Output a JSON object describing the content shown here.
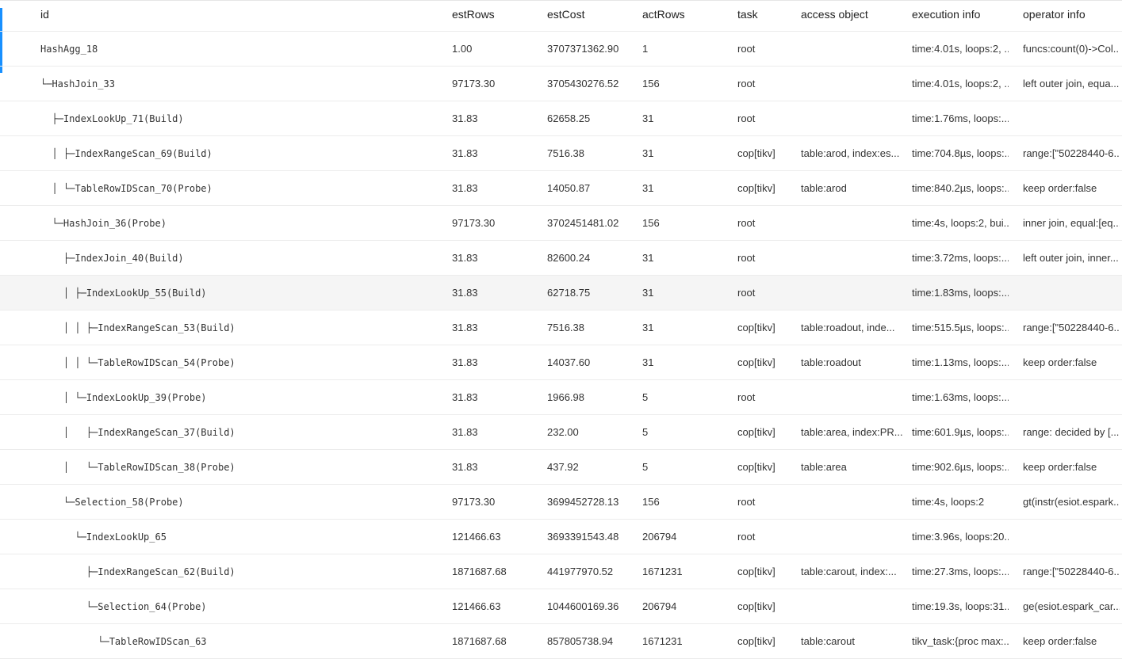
{
  "columns": {
    "id": "id",
    "estRows": "estRows",
    "estCost": "estCost",
    "actRows": "actRows",
    "task": "task",
    "access_object": "access object",
    "execution_info": "execution info",
    "operator_info": "operator info"
  },
  "rows": [
    {
      "id": "HashAgg_18",
      "estRows": "1.00",
      "estCost": "3707371362.90",
      "actRows": "1",
      "task": "root",
      "access": "",
      "exec": "time:4.01s, loops:2, ...",
      "op": "funcs:count(0)->Col..."
    },
    {
      "id": "└─HashJoin_33",
      "estRows": "97173.30",
      "estCost": "3705430276.52",
      "actRows": "156",
      "task": "root",
      "access": "",
      "exec": "time:4.01s, loops:2, ...",
      "op": "left outer join, equa..."
    },
    {
      "id": "  ├─IndexLookUp_71(Build)",
      "estRows": "31.83",
      "estCost": "62658.25",
      "actRows": "31",
      "task": "root",
      "access": "",
      "exec": "time:1.76ms, loops:...",
      "op": ""
    },
    {
      "id": "  │ ├─IndexRangeScan_69(Build)",
      "estRows": "31.83",
      "estCost": "7516.38",
      "actRows": "31",
      "task": "cop[tikv]",
      "access": "table:arod, index:es...",
      "exec": "time:704.8µs, loops:...",
      "op": "range:[\"50228440-6..."
    },
    {
      "id": "  │ └─TableRowIDScan_70(Probe)",
      "estRows": "31.83",
      "estCost": "14050.87",
      "actRows": "31",
      "task": "cop[tikv]",
      "access": "table:arod",
      "exec": "time:840.2µs, loops:...",
      "op": "keep order:false"
    },
    {
      "id": "  └─HashJoin_36(Probe)",
      "estRows": "97173.30",
      "estCost": "3702451481.02",
      "actRows": "156",
      "task": "root",
      "access": "",
      "exec": "time:4s, loops:2, bui...",
      "op": "inner join, equal:[eq..."
    },
    {
      "id": "    ├─IndexJoin_40(Build)",
      "estRows": "31.83",
      "estCost": "82600.24",
      "actRows": "31",
      "task": "root",
      "access": "",
      "exec": "time:3.72ms, loops:...",
      "op": "left outer join, inner..."
    },
    {
      "id": "    │ ├─IndexLookUp_55(Build)",
      "estRows": "31.83",
      "estCost": "62718.75",
      "actRows": "31",
      "task": "root",
      "access": "",
      "exec": "time:1.83ms, loops:...",
      "op": ""
    },
    {
      "id": "    │ │ ├─IndexRangeScan_53(Build)",
      "estRows": "31.83",
      "estCost": "7516.38",
      "actRows": "31",
      "task": "cop[tikv]",
      "access": "table:roadout, inde...",
      "exec": "time:515.5µs, loops:...",
      "op": "range:[\"50228440-6..."
    },
    {
      "id": "    │ │ └─TableRowIDScan_54(Probe)",
      "estRows": "31.83",
      "estCost": "14037.60",
      "actRows": "31",
      "task": "cop[tikv]",
      "access": "table:roadout",
      "exec": "time:1.13ms, loops:...",
      "op": "keep order:false"
    },
    {
      "id": "    │ └─IndexLookUp_39(Probe)",
      "estRows": "31.83",
      "estCost": "1966.98",
      "actRows": "5",
      "task": "root",
      "access": "",
      "exec": "time:1.63ms, loops:...",
      "op": ""
    },
    {
      "id": "    │   ├─IndexRangeScan_37(Build)",
      "estRows": "31.83",
      "estCost": "232.00",
      "actRows": "5",
      "task": "cop[tikv]",
      "access": "table:area, index:PR...",
      "exec": "time:601.9µs, loops:...",
      "op": "range: decided by [..."
    },
    {
      "id": "    │   └─TableRowIDScan_38(Probe)",
      "estRows": "31.83",
      "estCost": "437.92",
      "actRows": "5",
      "task": "cop[tikv]",
      "access": "table:area",
      "exec": "time:902.6µs, loops:...",
      "op": "keep order:false"
    },
    {
      "id": "    └─Selection_58(Probe)",
      "estRows": "97173.30",
      "estCost": "3699452728.13",
      "actRows": "156",
      "task": "root",
      "access": "",
      "exec": "time:4s, loops:2",
      "op": "gt(instr(esiot.espark..."
    },
    {
      "id": "      └─IndexLookUp_65",
      "estRows": "121466.63",
      "estCost": "3693391543.48",
      "actRows": "206794",
      "task": "root",
      "access": "",
      "exec": "time:3.96s, loops:20...",
      "op": ""
    },
    {
      "id": "        ├─IndexRangeScan_62(Build)",
      "estRows": "1871687.68",
      "estCost": "441977970.52",
      "actRows": "1671231",
      "task": "cop[tikv]",
      "access": "table:carout, index:...",
      "exec": "time:27.3ms, loops:...",
      "op": "range:[\"50228440-6..."
    },
    {
      "id": "        └─Selection_64(Probe)",
      "estRows": "121466.63",
      "estCost": "1044600169.36",
      "actRows": "206794",
      "task": "cop[tikv]",
      "access": "",
      "exec": "time:19.3s, loops:31...",
      "op": "ge(esiot.espark_car..."
    },
    {
      "id": "          └─TableRowIDScan_63",
      "estRows": "1871687.68",
      "estCost": "857805738.94",
      "actRows": "1671231",
      "task": "cop[tikv]",
      "access": "table:carout",
      "exec": "tikv_task:{proc max:...",
      "op": "keep order:false"
    }
  ],
  "selected_row_index": 7,
  "colors": {
    "accent": "#1890ff",
    "selected_row": "#f5f5f5",
    "border": "#ececec"
  }
}
